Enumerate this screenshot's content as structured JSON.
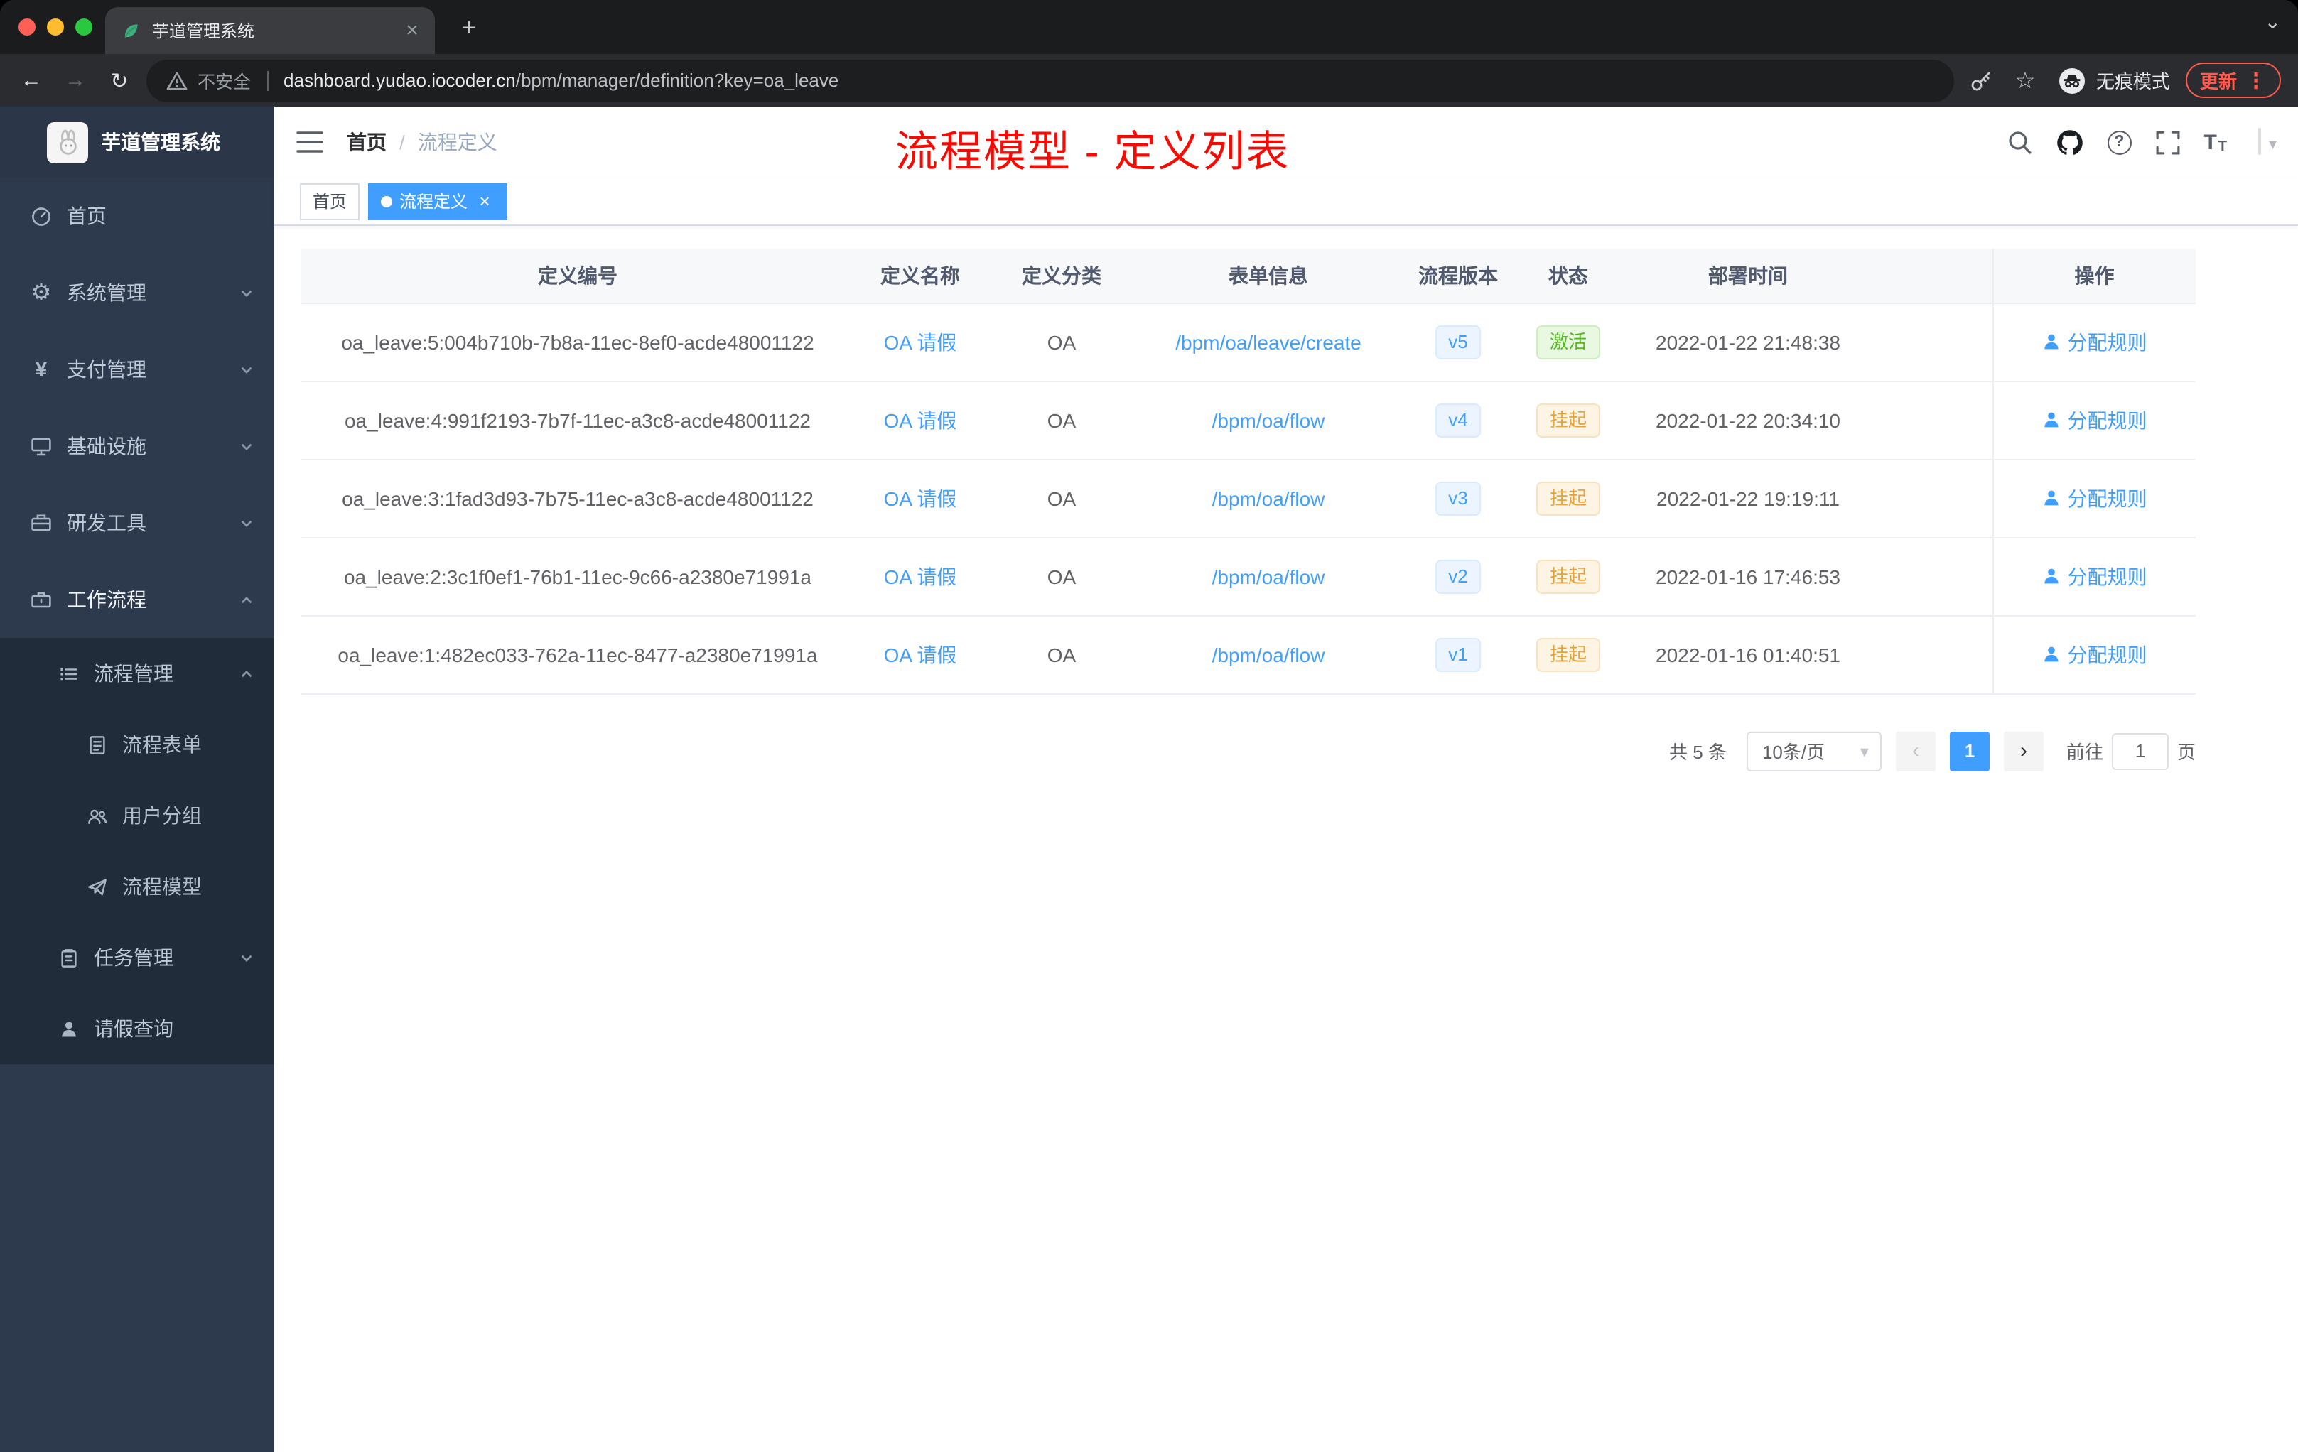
{
  "browser": {
    "tab_title": "芋道管理系统",
    "security_label": "不安全",
    "url_host": "dashboard.yudao.iocoder.cn",
    "url_path": "/bpm/manager/definition?key=oa_leave",
    "incognito_label": "无痕模式",
    "update_label": "更新"
  },
  "icons": {
    "close": "×",
    "plus": "+",
    "tab_search": "⌄",
    "back": "←",
    "forward": "→",
    "refresh": "↻",
    "star": "☆",
    "menu_dots": "⋮",
    "gear": "⚙",
    "yen": "¥",
    "question": "?",
    "caret_down": "▾",
    "prev": "‹",
    "next": "›",
    "font_size_big": "T",
    "font_size_small": "T",
    "breadcrumb_sep": "/"
  },
  "sidebar": {
    "logo_title": "芋道管理系统",
    "items": [
      {
        "label": "首页"
      },
      {
        "label": "系统管理"
      },
      {
        "label": "支付管理"
      },
      {
        "label": "基础设施"
      },
      {
        "label": "研发工具"
      },
      {
        "label": "工作流程"
      }
    ],
    "sub": {
      "process_mgmt": "流程管理",
      "children": [
        {
          "label": "流程表单"
        },
        {
          "label": "用户分组"
        },
        {
          "label": "流程模型"
        }
      ],
      "task_mgmt": "任务管理",
      "leave_query": "请假查询"
    }
  },
  "navbar": {
    "breadcrumb_home": "首页",
    "breadcrumb_current": "流程定义",
    "annotation": "流程模型 - 定义列表"
  },
  "tags": {
    "home": "首页",
    "current": "流程定义"
  },
  "table": {
    "headers": [
      "定义编号",
      "定义名称",
      "定义分类",
      "表单信息",
      "流程版本",
      "状态",
      "部署时间",
      "操作"
    ],
    "rows": [
      {
        "id": "oa_leave:5:004b710b-7b8a-11ec-8ef0-acde48001122",
        "name": "OA 请假",
        "category": "OA",
        "form": "/bpm/oa/leave/create",
        "version": "v5",
        "status": "激活",
        "status_type": "success",
        "deployed": "2022-01-22 21:48:38",
        "action": "分配规则"
      },
      {
        "id": "oa_leave:4:991f2193-7b7f-11ec-a3c8-acde48001122",
        "name": "OA 请假",
        "category": "OA",
        "form": "/bpm/oa/flow",
        "version": "v4",
        "status": "挂起",
        "status_type": "warning",
        "deployed": "2022-01-22 20:34:10",
        "action": "分配规则"
      },
      {
        "id": "oa_leave:3:1fad3d93-7b75-11ec-a3c8-acde48001122",
        "name": "OA 请假",
        "category": "OA",
        "form": "/bpm/oa/flow",
        "version": "v3",
        "status": "挂起",
        "status_type": "warning",
        "deployed": "2022-01-22 19:19:11",
        "action": "分配规则"
      },
      {
        "id": "oa_leave:2:3c1f0ef1-76b1-11ec-9c66-a2380e71991a",
        "name": "OA 请假",
        "category": "OA",
        "form": "/bpm/oa/flow",
        "version": "v2",
        "status": "挂起",
        "status_type": "warning",
        "deployed": "2022-01-16 17:46:53",
        "action": "分配规则"
      },
      {
        "id": "oa_leave:1:482ec033-762a-11ec-8477-a2380e71991a",
        "name": "OA 请假",
        "category": "OA",
        "form": "/bpm/oa/flow",
        "version": "v1",
        "status": "挂起",
        "status_type": "warning",
        "deployed": "2022-01-16 01:40:51",
        "action": "分配规则"
      }
    ]
  },
  "pagination": {
    "total": "共 5 条",
    "page_size": "10条/页",
    "page": "1",
    "goto_label": "前往",
    "goto_value": "1",
    "unit": "页"
  },
  "colors": {
    "primary": "#409eff",
    "success": "#67c23a",
    "warning": "#e6a23c",
    "annotation": "#ff0000",
    "sidebar_bg": "#2d3a4d",
    "submenu_bg": "#212c3b"
  }
}
